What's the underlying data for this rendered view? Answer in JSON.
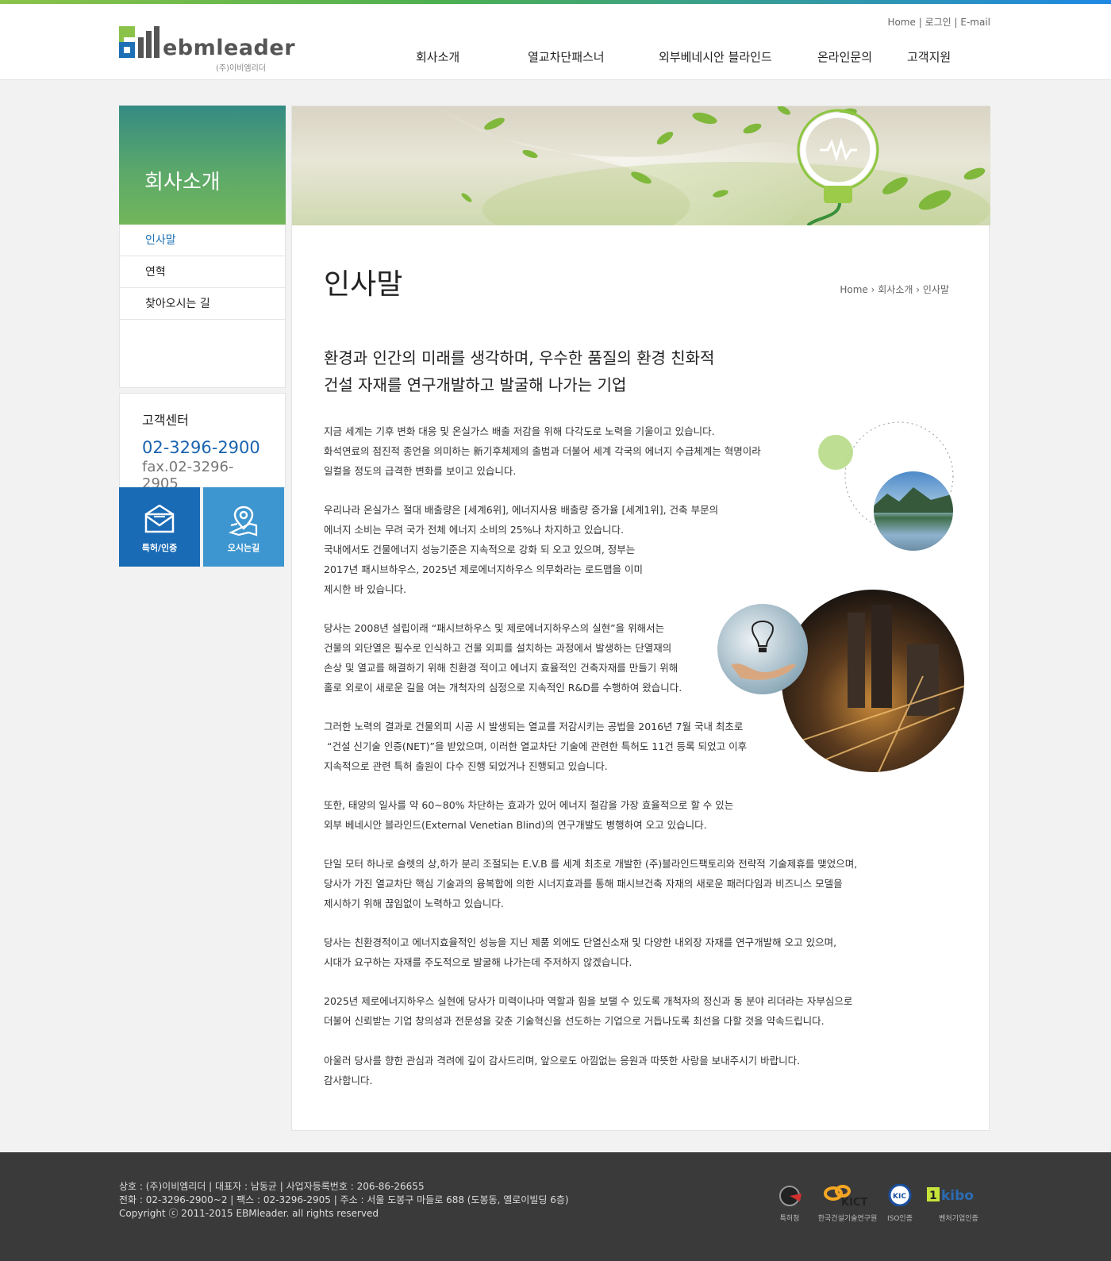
{
  "header": {
    "brand": "ebmleader",
    "brand_sub": "(주)이비엠리더",
    "util_links": [
      "Home",
      "로그인",
      "E-mail"
    ],
    "nav": [
      "회사소개",
      "열교차단패스너",
      "외부베네시안 블라인드",
      "온라인문의",
      "고객지원"
    ]
  },
  "sidebar": {
    "title": "회사소개",
    "items": [
      {
        "label": "인사말"
      },
      {
        "label": "연혁"
      },
      {
        "label": "찾아오시는 길"
      }
    ],
    "customer_center": {
      "label": "고객센터",
      "phone": "02-3296-2900",
      "fax": "fax.02-3296-2905"
    },
    "quick_links": [
      "특허/인증",
      "오시는길"
    ]
  },
  "colors": {
    "accent_blue": "#1a6fb5",
    "quick_dark": "#1a6bb5",
    "quick_light": "#3e96d0",
    "lnb_green": "#5ba86a"
  },
  "main": {
    "page_title": "인사말",
    "breadcrumb": [
      "Home",
      "회사소개",
      "인사말"
    ],
    "headline_1": "환경과 인간의 미래를 생각하며, 우수한 품질의 환경 친화적",
    "headline_2": "건설 자재를 연구개발하고 발굴해 나가는 기업",
    "paragraphs": [
      "지금 세계는 기후 변화 대응 및 온실가스 배출 저감을 위해 다각도로 노력을 기울이고 있습니다.\n화석연료의 점진적 종언을 의미하는 新기후체제의 출범과 더불어 세계 각국의 에너지 수급체계는 혁명이라\n일컬을 정도의 급격한 변화를 보이고 있습니다.",
      "우리나라 온실가스 절대 배출량은 [세계6위], 에너지사용 배출량 증가율 [세계1위], 건축 부문의\n에너지 소비는 무려 국가 전체 에너지 소비의 25%나 차지하고 있습니다.\n국내에서도 건물에너지 성능기준은 지속적으로 강화 되 오고 있으며, 정부는\n2017년 패시브하우스, 2025년 제로에너지하우스 의무화라는 로드맵을 이미\n제시한 바 있습니다.",
      "당사는 2008년 설립이래 “패시브하우스 및 제로에너지하우스의 실현”을 위해서는\n건물의 외단열은 필수로 인식하고 건물 외피를 설치하는 과정에서 발생하는 단열재의\n손상 및 열교를 해결하기 위해 친환경 적이고 에너지 효율적인 건축자재를 만들기 위해\n홀로 외로이 새로운 길을 여는 개척자의 심정으로 지속적인 R&D를 수행하여 왔습니다.",
      "그러한 노력의 결과로 건물외피 시공 시 발생되는 열교를 저감시키는 공법을 2016년 7월 국내 최초로\n “건설 신기술 인증(NET)”을 받았으며, 이러한 열교차단 기술에 관련한 특허도 11건 등록 되었고 이후\n지속적으로 관련 특허 출원이 다수 진행 되었거나 진행되고 있습니다.",
      "또한, 태양의 일사를 약 60~80% 차단하는 효과가 있어 에너지 절감을 가장 효율적으로 할 수 있는\n외부 베네시안 블라인드(External Venetian Blind)의 연구개발도 병행하여 오고 있습니다.",
      "단일 모터 하나로 슬렛의 상,하가 분리 조절되는 E.V.B 를 세계 최초로 개발한 (주)블라인드팩토리와 전략적 기술제휴를 맺었으며,\n당사가 가진 열교차단 핵심 기술과의 융복합에 의한 시너지효과를 통해 패시브건축 자재의 새로운 패러다임과 비즈니스 모델을\n제시하기 위해 끊임없이 노력하고 있습니다.",
      "당사는 친환경적이고 에너지효율적인 성능을 지닌 제품 외에도 단열신소재 및 다양한 내외장 자재를 연구개발해 오고 있으며,\n시대가 요구하는 자재를 주도적으로 발굴해 나가는데 주저하지 않겠습니다.",
      "2025년 제로에너지하우스 실현에 당사가 미력이나마 역할과 힘을 보탤 수 있도록 개척자의 정신과 동 분야 리더라는 자부심으로\n더불어 신뢰받는 기업 창의성과 전문성을 갖춘 기술혁신을 선도하는 기업으로 거듭나도록 최선을 다할 것을 약속드립니다.",
      "아울러 당사를 향한 관심과 격려에 깊이 감사드리며, 앞으로도 아낌없는 응원과 따뜻한 사랑을 보내주시기 바랍니다.\n감사합니다."
    ]
  },
  "footer": {
    "line1": "상호 : (주)이비엠리더  |  대표자 : 남동균  |  사업자등록번호 : 206-86-26655",
    "line2": "전화 : 02-3296-2900~2  |  팩스 : 02-3296-2905  |  주소 : 서울 도봉구 마들로 688 (도봉동, 옐로이빌딩 6층)",
    "line3": "Copyright ⓒ 2011-2015 EBMleader. all rights reserved",
    "certs": [
      "특허청",
      "한국건설기술연구원",
      "ISO인증",
      "벤처기업인증"
    ]
  }
}
